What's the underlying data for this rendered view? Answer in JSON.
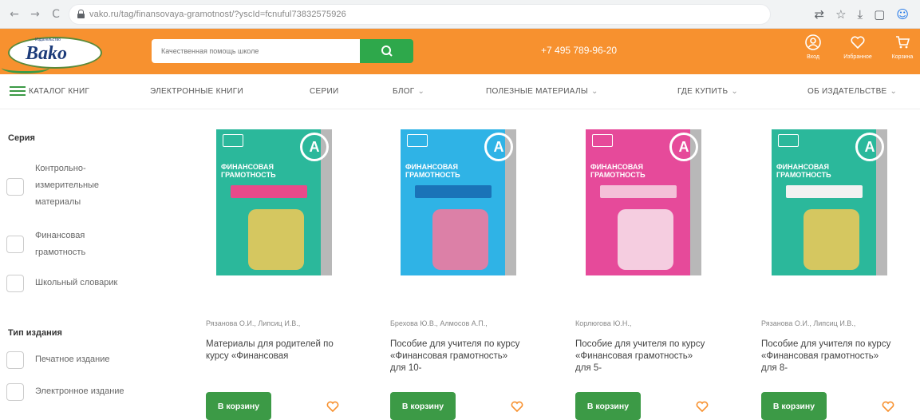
{
  "browser": {
    "url": "vako.ru/tag/finansovaya-gramotnost/?yscId=fcnuful73832575926",
    "back": "←",
    "forward": "→",
    "reload": "C",
    "icons": [
      "translate-icon",
      "star-icon",
      "download-icon",
      "sidebar-icon",
      "profile-icon"
    ]
  },
  "header": {
    "logo_text": "Bako",
    "logo_tag": "Издательство",
    "search_placeholder": "Качественная помощь школе",
    "phone": "+7 495 789-96-20",
    "icons": [
      {
        "name": "login",
        "label": "Вход"
      },
      {
        "name": "favorites",
        "label": "Избранное"
      },
      {
        "name": "cart",
        "label": "Корзина"
      }
    ]
  },
  "nav": {
    "catalog": "КАТАЛОГ КНИГ",
    "items": [
      {
        "label": "ЭЛЕКТРОННЫЕ КНИГИ",
        "chevron": ""
      },
      {
        "label": "СЕРИИ",
        "chevron": ""
      },
      {
        "label": "БЛОГ",
        "chevron": "⌄"
      },
      {
        "label": "ПОЛЕЗНЫЕ МАТЕРИАЛЫ",
        "chevron": "⌄"
      },
      {
        "label": "ГДЕ КУПИТЬ",
        "chevron": "⌄"
      },
      {
        "label": "ОБ ИЗДАТЕЛЬСТВЕ",
        "chevron": "⌄"
      }
    ]
  },
  "filters": {
    "series_title": "Серия",
    "series": [
      "Контрольно-измерительные материалы",
      "Финансовая грамотность",
      "Школьный словарик"
    ],
    "type_title": "Тип издания",
    "types": [
      "Печатное издание",
      "Электронное издание"
    ]
  },
  "products": [
    {
      "author": "Рязанова О.И., Липсиц И.В.,",
      "title": "Материалы для родителей по курсу «Финансовая",
      "cart_label": "В корзину",
      "cover_title": "ФИНАНСОВАЯ ГРАМОТНОСТЬ",
      "cover_color": "#2bb89b",
      "plate_color": "#e84a8a",
      "art_color": "#e8c95a"
    },
    {
      "author": "Брехова Ю.В., Алмосов А.П.,",
      "title": "Пособие для учителя по курсу «Финансовая грамотность» для 10-",
      "cart_label": "В корзину",
      "cover_title": "ФИНАНСОВАЯ ГРАМОТНОСТЬ",
      "cover_color": "#2fb3e6",
      "plate_color": "#1a73b8",
      "art_color": "#f07aa0"
    },
    {
      "author": "Корлюгова Ю.Н.,",
      "title": "Пособие для учителя по курсу «Финансовая грамотность» для 5-",
      "cart_label": "В корзину",
      "cover_title": "ФИНАНСОВАЯ ГРАМОТНОСТЬ",
      "cover_color": "#e64a9a",
      "plate_color": "#f4c0d8",
      "art_color": "#f6dbe8"
    },
    {
      "author": "Рязанова О.И., Липсиц И.В.,",
      "title": "Пособие для учителя по курсу «Финансовая грамотность» для 8-",
      "cart_label": "В корзину",
      "cover_title": "ФИНАНСОВАЯ ГРАМОТНОСТЬ",
      "cover_color": "#2bb89b",
      "plate_color": "#f2f2f2",
      "art_color": "#e8c95a"
    }
  ],
  "colors": {
    "header": "#f7912f",
    "accent_green": "#3c9a46",
    "heart": "#f7912f"
  }
}
